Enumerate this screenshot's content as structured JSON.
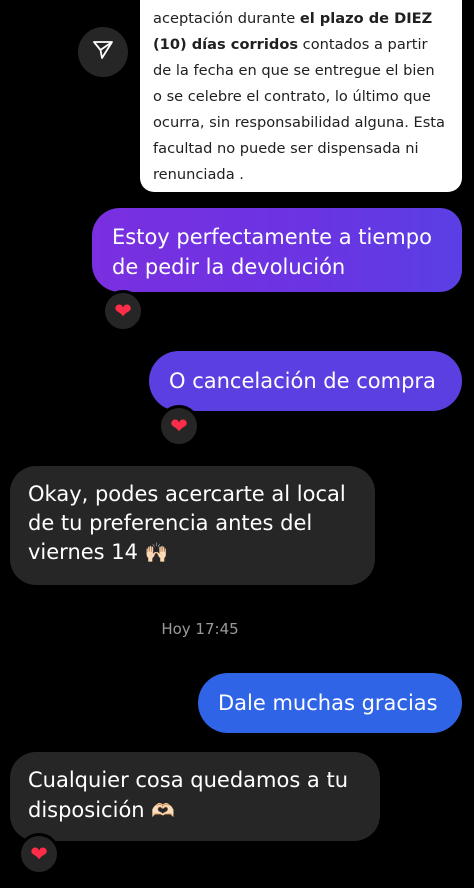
{
  "quoted_card": {
    "segments": [
      {
        "text": "aceptación durante ",
        "bold": false
      },
      {
        "text": "el plazo de DIEZ (10) días corridos",
        "bold": true
      },
      {
        "text": " contados a partir de la fecha en que se entregue el bien o se celebre el contrato, lo último que ocurra, sin responsabilidad alguna. Esta facultad no puede ser dispensada ni renunciada .",
        "bold": false
      }
    ],
    "share_icon": "paper-plane-icon"
  },
  "messages": [
    {
      "id": "m1",
      "direction": "outgoing",
      "text": "Estoy perfectamente a tiempo de pedir la devolución",
      "reaction": "❤"
    },
    {
      "id": "m2",
      "direction": "outgoing",
      "text": "O cancelación de compra",
      "reaction": "❤"
    },
    {
      "id": "m3",
      "direction": "incoming",
      "text": "Okay, podes acercarte al local de tu preferencia antes del viernes 14",
      "emoji": "🙌🏻"
    },
    {
      "id": "m4",
      "direction": "outgoing",
      "text": "Dale muchas gracias"
    },
    {
      "id": "m5",
      "direction": "incoming",
      "text": "Cualquier cosa quedamos a tu disposición",
      "emoji": "🫶🏻",
      "reaction": "❤"
    }
  ],
  "timestamp": "Hoy 17:45",
  "colors": {
    "background": "#000000",
    "incoming_bubble": "#262626",
    "outgoing_purple": "#7a2fe0",
    "outgoing_violet": "#5b3fe0",
    "outgoing_blue": "#2f64e6",
    "reaction_heart": "#ff2d48",
    "timestamp_text": "#9a9a9a"
  }
}
